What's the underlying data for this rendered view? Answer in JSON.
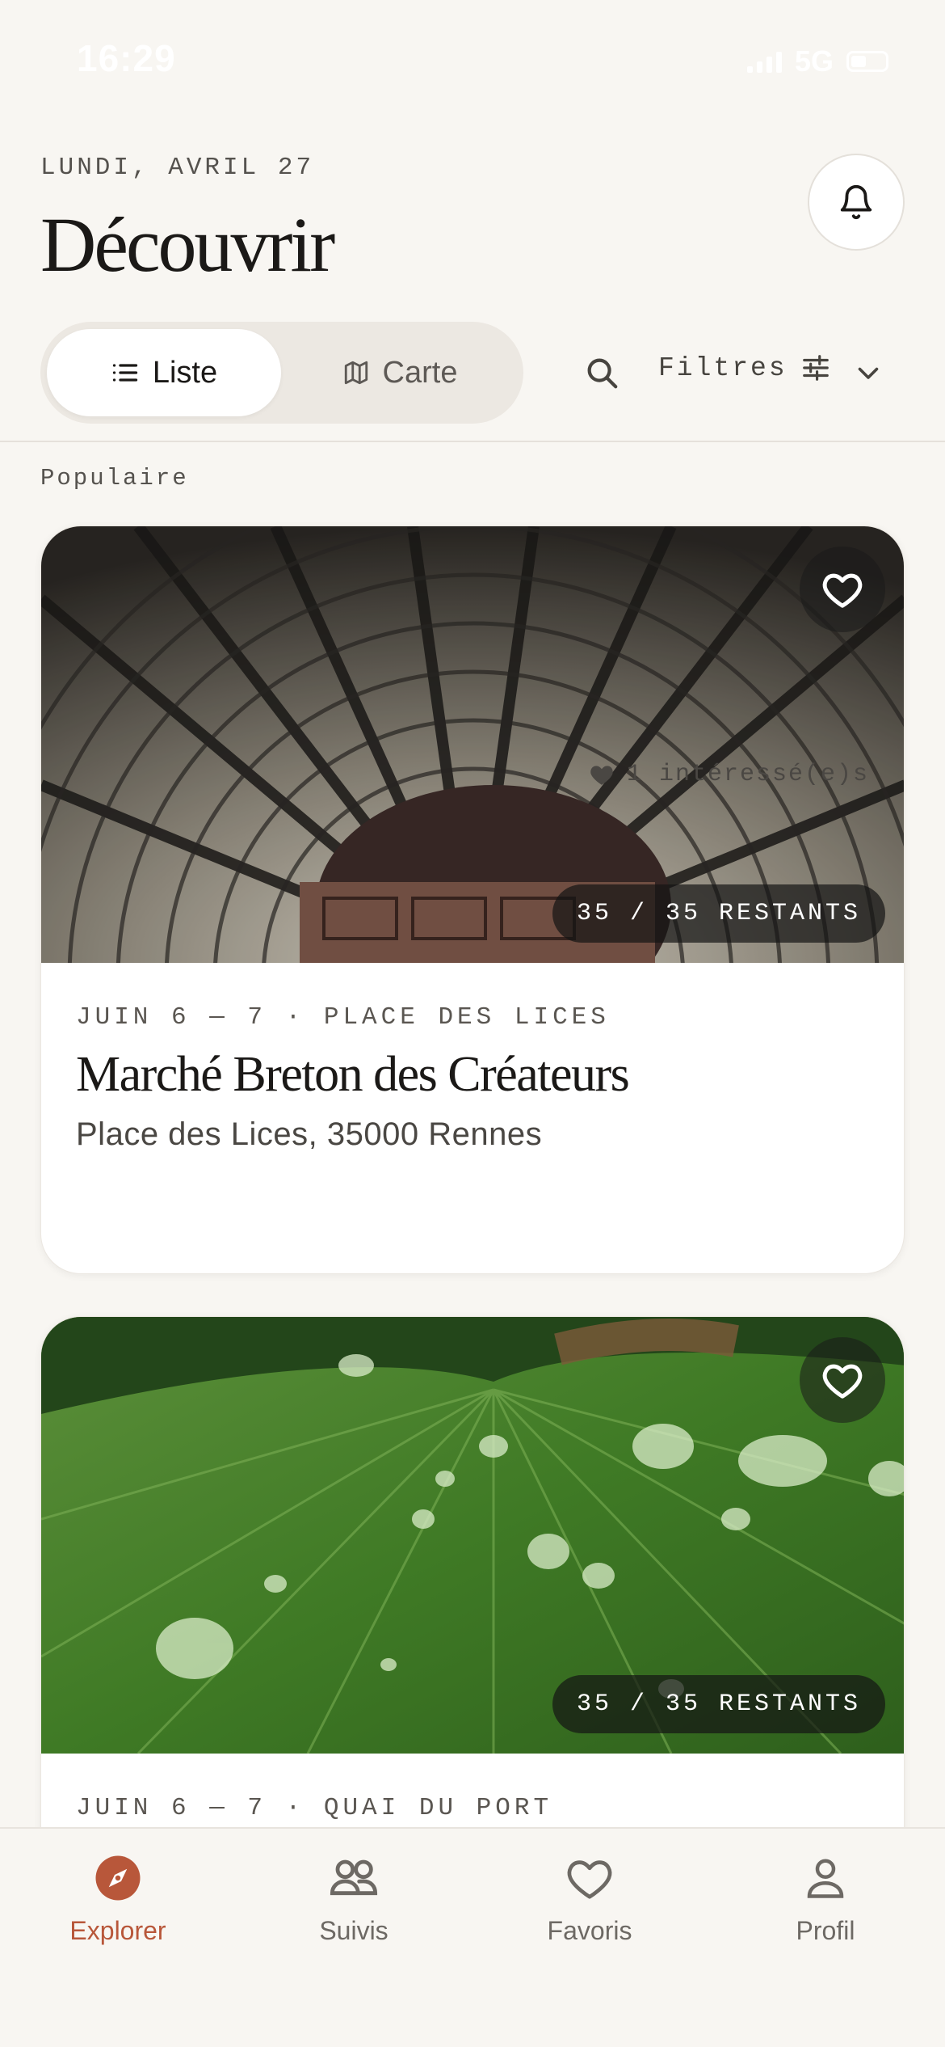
{
  "status": {
    "time": "16:29",
    "network": "5G"
  },
  "header": {
    "date": "LUNDI, AVRIL 27",
    "title": "Découvrir"
  },
  "view_toggle": {
    "list_label": "Liste",
    "map_label": "Carte",
    "active": "Liste"
  },
  "toolbar": {
    "filters_label": "Filtres"
  },
  "section": {
    "label": "Populaire"
  },
  "events": [
    {
      "meta": "JUIN 6 — 7 · PLACE DES LICES",
      "title": "Marché Breton des Créateurs",
      "address": "Place des Lices, 35000 Rennes",
      "stock": "35 / 35 RESTANTS",
      "interested": "1 intéressé(e)s",
      "image": "market-hall-roof-photo"
    },
    {
      "meta": "JUIN 6 — 7 · QUAI DU PORT",
      "stock": "35 / 35 RESTANTS",
      "image": "green-leaf-water-drops-photo"
    }
  ],
  "tabbar": {
    "items": [
      {
        "label": "Explorer",
        "icon": "compass-icon",
        "active": true
      },
      {
        "label": "Suivis",
        "icon": "people-icon",
        "active": false
      },
      {
        "label": "Favoris",
        "icon": "heart-icon",
        "active": false
      },
      {
        "label": "Profil",
        "icon": "person-icon",
        "active": false
      }
    ]
  },
  "colors": {
    "accent": "#b8573a",
    "background": "#f8f6f2",
    "card": "#ffffff"
  }
}
